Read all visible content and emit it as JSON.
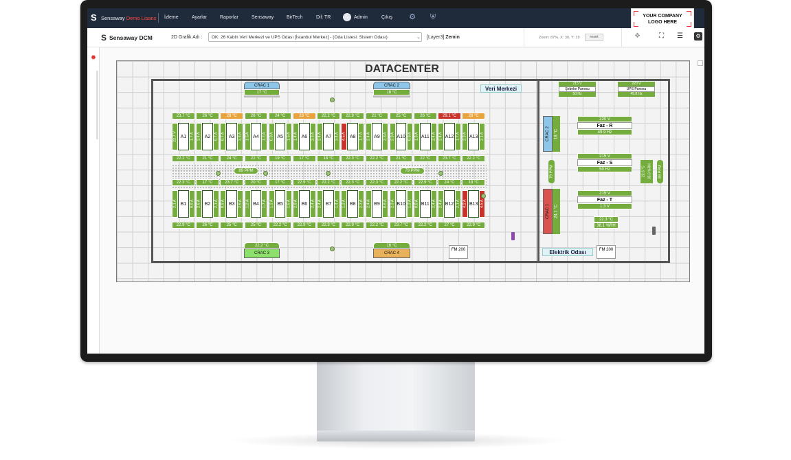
{
  "nav": {
    "brand_prefix": "Sensaway",
    "brand_license": "Demo Lisans",
    "items": [
      "İzleme",
      "Ayarlar",
      "Raporlar",
      "Sensaway",
      "BirTech",
      "Dil: TR",
      "Admin",
      "Çıkış"
    ],
    "company_logo_line1": "YOUR COMPANY",
    "company_logo_line2": "LOGO HERE"
  },
  "toolbar": {
    "brand": "Sensaway DCM",
    "grafik_label": "2D Grafik Adı :",
    "selected_graphic": "OK: 26 Kabin Veri Merkezi ve UPS Odası [İstanbul Merkez] - (Oda Listesi: Sistem Odası)",
    "layer_label": "[Layer3]",
    "layer_name": "Zemin",
    "zoom_text": "Zoom: 87%, X: 30, Y: 19",
    "reset_label": "reset"
  },
  "map": {
    "title": "DATACENTER",
    "room_veri": "Veri Merkezi",
    "room_elektrik": "Elektrik Odası",
    "crac": [
      {
        "name": "CRAC 1",
        "value": "24.1 °C",
        "status": "red"
      },
      {
        "name": "CRAC 2",
        "value": "18 °C",
        "status": "blue"
      },
      {
        "name": "CRAC 1",
        "value": "17 °C",
        "status": "blue"
      },
      {
        "name": "CRAC 2",
        "value": "18 °C",
        "status": "blue"
      },
      {
        "name": "CRAC 3",
        "value": "22.2 °C",
        "status": "green"
      },
      {
        "name": "CRAC 4",
        "value": "16 °C",
        "status": "orange"
      }
    ],
    "fm200": [
      "FM 200",
      "FM 200"
    ],
    "row_a_top_temps": [
      {
        "v": "23.7 °C",
        "s": "g"
      },
      {
        "v": "26 °C",
        "s": "g"
      },
      {
        "v": "28 °C",
        "s": "o"
      },
      {
        "v": "26 °C",
        "s": "g"
      },
      {
        "v": "24 °C",
        "s": "g"
      },
      {
        "v": "28 °C",
        "s": "o"
      },
      {
        "v": "22.2 °C",
        "s": "g"
      },
      {
        "v": "22.9 °C",
        "s": "g"
      },
      {
        "v": "21 °C",
        "s": "g"
      },
      {
        "v": "25 °C",
        "s": "g"
      },
      {
        "v": "26 °C",
        "s": "g"
      },
      {
        "v": "29.1 °C",
        "s": "r"
      },
      {
        "v": "28 °C",
        "s": "o"
      }
    ],
    "row_a_cabinets": [
      {
        "name": "A1",
        "l": "22.7 V",
        "r": "1.7 A",
        "lc": "g",
        "rc": "g"
      },
      {
        "name": "A2",
        "l": "2.4 A",
        "r": "0.7 A",
        "lc": "g",
        "rc": "g"
      },
      {
        "name": "A3",
        "l": "0.7 A",
        "r": "3.3 A",
        "lc": "g",
        "rc": "g"
      },
      {
        "name": "A4",
        "l": "1.5 A",
        "r": "1.2 A",
        "lc": "g",
        "rc": "g"
      },
      {
        "name": "A5",
        "l": "0.8 A",
        "r": "1.5 A",
        "lc": "g",
        "rc": "g"
      },
      {
        "name": "A6",
        "l": "1.4 A",
        "r": "2.3 A",
        "lc": "g",
        "rc": "g"
      },
      {
        "name": "A7",
        "l": "2.4 A",
        "r": "3.4 A",
        "lc": "g",
        "rc": "g"
      },
      {
        "name": "A8",
        "l": "4.5 A",
        "r": "1.7 A",
        "lc": "r",
        "rc": "g"
      },
      {
        "name": "A9",
        "l": "2.4 A",
        "r": "2.3 A",
        "lc": "g",
        "rc": "g"
      },
      {
        "name": "A10",
        "l": "2.3 A",
        "r": "0.8 A",
        "lc": "g",
        "rc": "g"
      },
      {
        "name": "A11",
        "l": "1.3 A",
        "r": "2.4 A",
        "lc": "g",
        "rc": "g"
      },
      {
        "name": "A12",
        "l": "2.4 A",
        "r": "1.7 A",
        "lc": "g",
        "rc": "g"
      },
      {
        "name": "A13",
        "l": "2.3 A",
        "r": "2.1 A",
        "lc": "g",
        "rc": "g"
      }
    ],
    "row_a_bottom_temps": [
      "22.2 °C",
      "21 °C",
      "24 °C",
      "22 °C",
      "19 °C",
      "17 °C",
      "18 °C",
      "22.3 °C",
      "22.2 °C",
      "21 °C",
      "22 °C",
      "23.7 °C",
      "22.2 °C"
    ],
    "aisle_ppm": [
      "89 PPM",
      "79 PPM"
    ],
    "row_b_top_temps": [
      "22.3 °C",
      "17 °C",
      "23.7 °C",
      "20 °C",
      "17 °C",
      "22.9 °C",
      "22.2 °C",
      "22.3 °C",
      "22.3 °C",
      "22.2 °C",
      "22.9 °C",
      "24 °C",
      "19 °C"
    ],
    "row_b_cabinets": [
      {
        "name": "B1",
        "l": "2.1 A",
        "r": "0.8 A",
        "lc": "g",
        "rc": "g"
      },
      {
        "name": "B2",
        "l": "2.6 A",
        "r": "2.1 A",
        "lc": "g",
        "rc": "g"
      },
      {
        "name": "B3",
        "l": "0.8 A",
        "r": "2.6 A",
        "lc": "g",
        "rc": "g"
      },
      {
        "name": "B4",
        "l": "1.2 A",
        "r": "1.7 A",
        "lc": "g",
        "rc": "g"
      },
      {
        "name": "B5",
        "l": "1.2 A",
        "r": "1.5 A",
        "lc": "g",
        "rc": "g"
      },
      {
        "name": "B6",
        "l": "2.9 A",
        "r": "2.4 A",
        "lc": "g",
        "rc": "g"
      },
      {
        "name": "B7",
        "l": "2.4 A",
        "r": "1.4 A",
        "lc": "g",
        "rc": "g"
      },
      {
        "name": "B8",
        "l": "1.2 A",
        "r": "2.3 A",
        "lc": "g",
        "rc": "g"
      },
      {
        "name": "B9",
        "l": "2.4 A",
        "r": "0.8 A",
        "lc": "g",
        "rc": "g"
      },
      {
        "name": "B10",
        "l": "2.3 A",
        "r": "1.2 A",
        "lc": "g",
        "rc": "g"
      },
      {
        "name": "B11",
        "l": "0.8 A",
        "r": "2.4 A",
        "lc": "g",
        "rc": "g"
      },
      {
        "name": "B12",
        "l": "2.4 A",
        "r": "2.1 A",
        "lc": "g",
        "rc": "g"
      },
      {
        "name": "B13",
        "l": "4.2 A",
        "r": "4.5 A",
        "lc": "r",
        "rc": "r"
      }
    ],
    "row_b_bottom_temps": [
      "22.9 °C",
      "26 °C",
      "25 °C",
      "25 °C",
      "22.2 °C",
      "22.9 °C",
      "22.3 °C",
      "22.9 °C",
      "22.2 °C",
      "23.7 °C",
      "22.2 °C",
      "27 °C",
      "22.9 °C"
    ],
    "panels": [
      {
        "volt": "215 V",
        "name": "Şebeke Panosu",
        "hz": "50 Hz"
      },
      {
        "volt": "220 V",
        "name": "UPS Panosu",
        "hz": "49.8 Hz"
      }
    ],
    "phases": [
      {
        "volt": "220 V",
        "name": "Faz - R",
        "hz": "49.9 Hz"
      },
      {
        "volt": "215 V",
        "name": "Faz - S",
        "hz": "50 Hz"
      },
      {
        "volt": "215 V",
        "name": "Faz - T",
        "hz": "1.3 V"
      }
    ],
    "elec_misc": {
      "ppm_left": "79 PPM",
      "temp_right": "22.6 °C",
      "rh_right": "35.6 %RH",
      "ppm_right": "89 PPM",
      "env_temp": "22.3 °C",
      "env_rh": "38.1 %RH"
    }
  }
}
